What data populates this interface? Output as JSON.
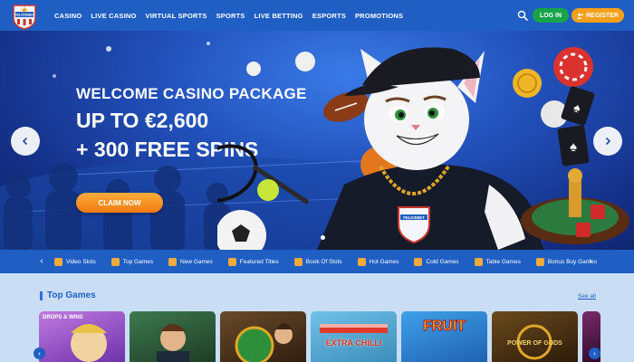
{
  "brand": {
    "name": "FELICEBET"
  },
  "nav": {
    "items": [
      {
        "label": "CASINO"
      },
      {
        "label": "LIVE CASINO"
      },
      {
        "label": "VIRTUAL SPORTS"
      },
      {
        "label": "SPORTS"
      },
      {
        "label": "LIVE BETTING"
      },
      {
        "label": "ESPORTS"
      },
      {
        "label": "PROMOTIONS"
      }
    ],
    "login_label": "LOG IN",
    "register_label": "REGISTER",
    "search_icon": "search-icon"
  },
  "hero": {
    "title_line1": "WELCOME CASINO PACKAGE",
    "title_line2": "UP TO €2,600",
    "title_line3": "+ 300 FREE SPINS",
    "cta_label": "CLAIM NOW",
    "mascot_badge": "FELICEBET"
  },
  "categories": [
    {
      "label": "Video Slots"
    },
    {
      "label": "Top Games"
    },
    {
      "label": "New Games"
    },
    {
      "label": "Featured Titles"
    },
    {
      "label": "Book Of Slots"
    },
    {
      "label": "Hot Games"
    },
    {
      "label": "Cold Games"
    },
    {
      "label": "Table Games"
    },
    {
      "label": "Bonus Buy Games"
    }
  ],
  "top_games": {
    "title": "Top Games",
    "see_all": "See all",
    "tiles": [
      {
        "label": "DROPS & WINS"
      },
      {
        "label": ""
      },
      {
        "label": ""
      },
      {
        "label": "EXTRA CHILLI"
      },
      {
        "label": "FRUIT"
      },
      {
        "label": "POWER OF GODS"
      },
      {
        "label": ""
      }
    ]
  },
  "colors": {
    "header": "#1f5fc4",
    "login": "#18a34a",
    "register": "#f6a01a",
    "cta": "#f07a12",
    "page_bg": "#c9def5"
  }
}
